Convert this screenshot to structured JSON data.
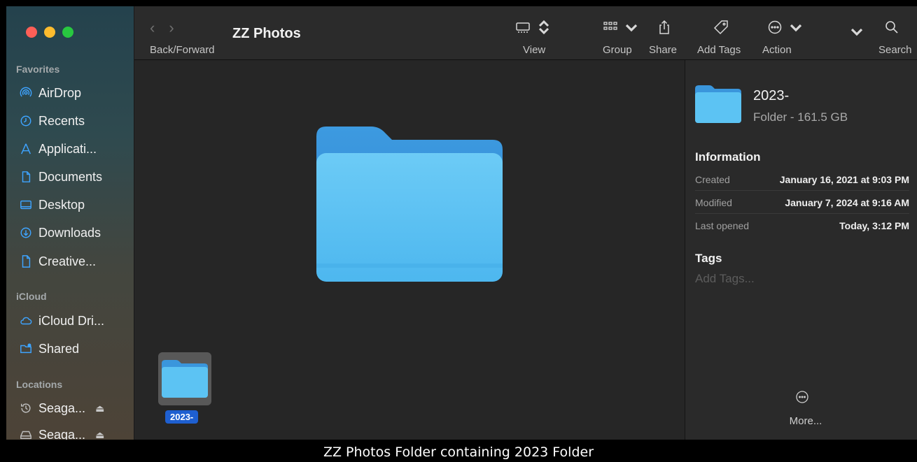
{
  "toolbar": {
    "title": "ZZ Photos",
    "back_forward_label": "Back/Forward",
    "view_label": "View",
    "group_label": "Group",
    "share_label": "Share",
    "add_tags_label": "Add Tags",
    "action_label": "Action",
    "search_label": "Search"
  },
  "sidebar": {
    "favorites_heading": "Favorites",
    "favorites": [
      {
        "label": "AirDrop",
        "icon": "airdrop-icon"
      },
      {
        "label": "Recents",
        "icon": "clock-icon"
      },
      {
        "label": "Applicati...",
        "icon": "applications-icon"
      },
      {
        "label": "Documents",
        "icon": "document-icon"
      },
      {
        "label": "Desktop",
        "icon": "desktop-icon"
      },
      {
        "label": "Downloads",
        "icon": "download-icon"
      },
      {
        "label": "Creative...",
        "icon": "file-icon"
      }
    ],
    "icloud_heading": "iCloud",
    "icloud": [
      {
        "label": "iCloud Dri...",
        "icon": "cloud-icon"
      },
      {
        "label": "Shared",
        "icon": "shared-folder-icon"
      }
    ],
    "locations_heading": "Locations",
    "locations": [
      {
        "label": "Seaga...",
        "icon": "time-machine-icon"
      },
      {
        "label": "Seaga...",
        "icon": "drive-icon"
      }
    ]
  },
  "content": {
    "selected_item_label": "2023-"
  },
  "inspector": {
    "name": "2023-",
    "kind_size": "Folder - 161.5 GB",
    "information_heading": "Information",
    "rows": [
      {
        "key": "Created",
        "value": "January 16, 2021 at 9:03 PM"
      },
      {
        "key": "Modified",
        "value": "January 7, 2024 at 9:16 AM"
      },
      {
        "key": "Last opened",
        "value": "Today, 3:12 PM"
      }
    ],
    "tags_heading": "Tags",
    "add_tags_placeholder": "Add Tags...",
    "more_label": "More..."
  },
  "caption": "ZZ Photos Folder containing 2023 Folder",
  "colors": {
    "accent_blue": "#3ea4ff",
    "folder_blue": "#5bc2f2",
    "selection_blue": "#1e5fd0"
  }
}
